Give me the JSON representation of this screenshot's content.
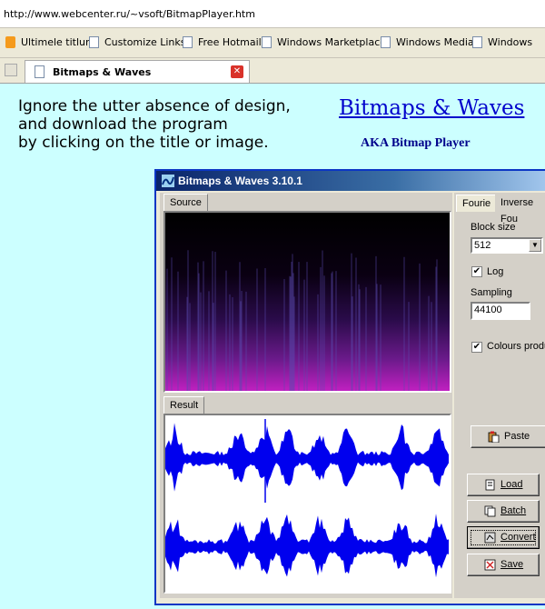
{
  "browser": {
    "address_url": "http://www.webcenter.ru/~vsoft/BitmapPlayer.htm",
    "links": [
      {
        "label": "Ultimele titluri",
        "icon": "rss-icon"
      },
      {
        "label": "Customize Links",
        "icon": "page-icon"
      },
      {
        "label": "Free Hotmail",
        "icon": "page-icon"
      },
      {
        "label": "Windows Marketplace",
        "icon": "page-icon"
      },
      {
        "label": "Windows Media",
        "icon": "page-icon"
      },
      {
        "label": "Windows",
        "icon": "page-icon"
      }
    ],
    "tab_title": "Bitmaps & Waves"
  },
  "page": {
    "intro_lines": [
      "Ignore the utter absence of design,",
      "and download the program",
      "by clicking on the title or image."
    ],
    "title": "Bitmaps & Waves",
    "subtitle": "AKA Bitmap Player"
  },
  "app": {
    "window_title": "Bitmaps & Waves 3.10.1",
    "source_tab": "Source",
    "result_tab": "Result",
    "right_tabs": [
      "Fourie",
      "Inverse Fou"
    ],
    "block_size_label": "Block size",
    "block_size_value": "512",
    "log_label": "Log",
    "log_checked": true,
    "sampling_label": "Sampling",
    "sampling_value": "44100",
    "colours_label": "Colours produ",
    "colours_checked": true,
    "buttons": {
      "paste": "Paste",
      "load": "Load",
      "batch": "Batch",
      "convert": "Convert",
      "save": "Save"
    }
  },
  "colors": {
    "page_background": "#ccffff",
    "title_link": "#0000cc",
    "waveform": "#0000ee",
    "spectrogram_accent": "#c020c0"
  }
}
